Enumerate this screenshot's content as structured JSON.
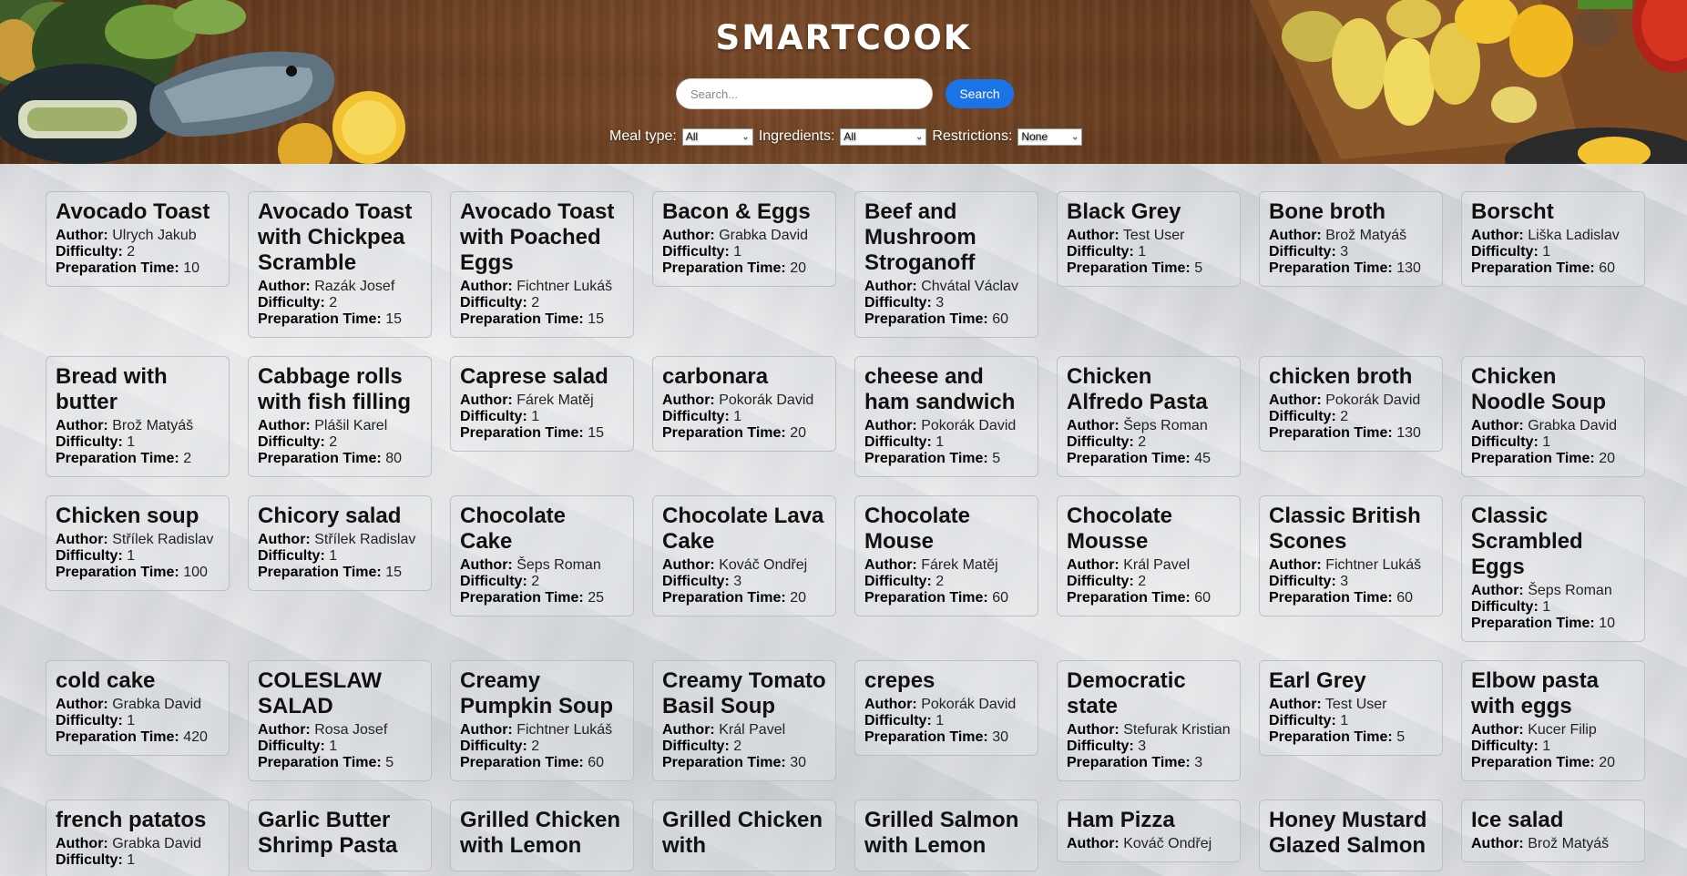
{
  "header": {
    "title": "SMARTCOOK",
    "search": {
      "placeholder": "Search...",
      "button_label": "Search"
    },
    "filters": {
      "meal_type": {
        "label": "Meal type:",
        "selected": "All"
      },
      "ingredients": {
        "label": "Ingredients:",
        "selected": "All"
      },
      "restrictions": {
        "label": "Restrictions:",
        "selected": "None"
      }
    }
  },
  "labels": {
    "author": "Author:",
    "difficulty": "Difficulty:",
    "preparation_time": "Preparation Time:"
  },
  "colors": {
    "accent": "#1a74e8",
    "header_wood": "#6e4223"
  },
  "recipes": [
    {
      "title": "Avocado Toast",
      "author": "Ulrych Jakub",
      "difficulty": "2",
      "time": "10"
    },
    {
      "title": "Avocado Toast with Chickpea Scramble",
      "author": "Razák Josef",
      "difficulty": "2",
      "time": "15"
    },
    {
      "title": "Avocado Toast with Poached Eggs",
      "author": "Fichtner Lukáš",
      "difficulty": "2",
      "time": "15"
    },
    {
      "title": "Bacon & Eggs",
      "author": "Grabka David",
      "difficulty": "1",
      "time": "20"
    },
    {
      "title": "Beef and Mushroom Stroganoff",
      "author": "Chvátal Václav",
      "difficulty": "3",
      "time": "60"
    },
    {
      "title": "Black Grey",
      "author": "Test User",
      "difficulty": "1",
      "time": "5"
    },
    {
      "title": "Bone broth",
      "author": "Brož Matyáš",
      "difficulty": "3",
      "time": "130"
    },
    {
      "title": "Borscht",
      "author": "Liška Ladislav",
      "difficulty": "1",
      "time": "60"
    },
    {
      "title": "Bread with butter",
      "author": "Brož Matyáš",
      "difficulty": "1",
      "time": "2"
    },
    {
      "title": "Cabbage rolls with fish filling",
      "author": "Plášil Karel",
      "difficulty": "2",
      "time": "80"
    },
    {
      "title": "Caprese salad",
      "author": "Fárek Matěj",
      "difficulty": "1",
      "time": "15"
    },
    {
      "title": "carbonara",
      "author": "Pokorák David",
      "difficulty": "1",
      "time": "20"
    },
    {
      "title": "cheese and ham sandwich",
      "author": "Pokorák David",
      "difficulty": "1",
      "time": "5"
    },
    {
      "title": "Chicken Alfredo Pasta",
      "author": "Šeps Roman",
      "difficulty": "2",
      "time": "45"
    },
    {
      "title": "chicken broth",
      "author": "Pokorák David",
      "difficulty": "2",
      "time": "130"
    },
    {
      "title": "Chicken Noodle Soup",
      "author": "Grabka David",
      "difficulty": "1",
      "time": "20"
    },
    {
      "title": "Chicken soup",
      "author": "Střílek Radislav",
      "difficulty": "1",
      "time": "100"
    },
    {
      "title": "Chicory salad",
      "author": "Střílek Radislav",
      "difficulty": "1",
      "time": "15"
    },
    {
      "title": "Chocolate Cake",
      "author": "Šeps Roman",
      "difficulty": "2",
      "time": "25"
    },
    {
      "title": "Chocolate Lava Cake",
      "author": "Kováč Ondřej",
      "difficulty": "3",
      "time": "20"
    },
    {
      "title": "Chocolate Mouse",
      "author": "Fárek Matěj",
      "difficulty": "2",
      "time": "60"
    },
    {
      "title": "Chocolate Mousse",
      "author": "Král Pavel",
      "difficulty": "2",
      "time": "60"
    },
    {
      "title": "Classic British Scones",
      "author": "Fichtner Lukáš",
      "difficulty": "3",
      "time": "60"
    },
    {
      "title": "Classic Scrambled Eggs",
      "author": "Šeps Roman",
      "difficulty": "1",
      "time": "10"
    },
    {
      "title": "cold cake",
      "author": "Grabka David",
      "difficulty": "1",
      "time": "420"
    },
    {
      "title": "COLESLAW SALAD",
      "author": "Rosa Josef",
      "difficulty": "1",
      "time": "5"
    },
    {
      "title": "Creamy Pumpkin Soup",
      "author": "Fichtner Lukáš",
      "difficulty": "2",
      "time": "60"
    },
    {
      "title": "Creamy Tomato Basil Soup",
      "author": "Král Pavel",
      "difficulty": "2",
      "time": "30"
    },
    {
      "title": "crepes",
      "author": "Pokorák David",
      "difficulty": "1",
      "time": "30"
    },
    {
      "title": "Democratic state",
      "author": "Stefurak Kristian",
      "difficulty": "3",
      "time": "3"
    },
    {
      "title": "Earl Grey",
      "author": "Test User",
      "difficulty": "1",
      "time": "5"
    },
    {
      "title": "Elbow pasta with eggs",
      "author": "Kucer Filip",
      "difficulty": "1",
      "time": "20"
    },
    {
      "title": "french patatos",
      "author": "Grabka David",
      "difficulty": "1",
      "time": ""
    },
    {
      "title": "Garlic Butter Shrimp Pasta",
      "author": "",
      "difficulty": "",
      "time": ""
    },
    {
      "title": "Grilled Chicken with Lemon",
      "author": "",
      "difficulty": "",
      "time": ""
    },
    {
      "title": "Grilled Chicken with",
      "author": "",
      "difficulty": "",
      "time": ""
    },
    {
      "title": "Grilled Salmon with Lemon",
      "author": "",
      "difficulty": "",
      "time": ""
    },
    {
      "title": "Ham Pizza",
      "author": "Kováč Ondřej",
      "difficulty": "",
      "time": ""
    },
    {
      "title": "Honey Mustard Glazed Salmon",
      "author": "",
      "difficulty": "",
      "time": ""
    },
    {
      "title": "Ice salad",
      "author": "Brož Matyáš",
      "difficulty": "",
      "time": ""
    }
  ]
}
